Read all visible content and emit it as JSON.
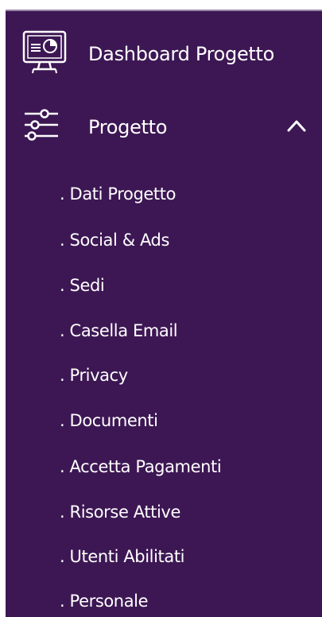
{
  "sidebar": {
    "background_color": "#3d1754",
    "text_color": "#ffffff",
    "items": [
      {
        "label": "Dashboard Progetto",
        "icon": "monitor-chart-icon"
      },
      {
        "label": "Progetto",
        "icon": "sliders-icon",
        "expanded": true,
        "expand_icon": "chevron-up-icon"
      }
    ],
    "submenu": [
      {
        "label": ". Dati Progetto"
      },
      {
        "label": ". Social & Ads"
      },
      {
        "label": ". Sedi"
      },
      {
        "label": ". Casella Email"
      },
      {
        "label": ". Privacy"
      },
      {
        "label": ". Documenti"
      },
      {
        "label": ". Accetta Pagamenti"
      },
      {
        "label": ". Risorse Attive"
      },
      {
        "label": ". Utenti Abilitati"
      },
      {
        "label": ". Personale"
      }
    ]
  }
}
